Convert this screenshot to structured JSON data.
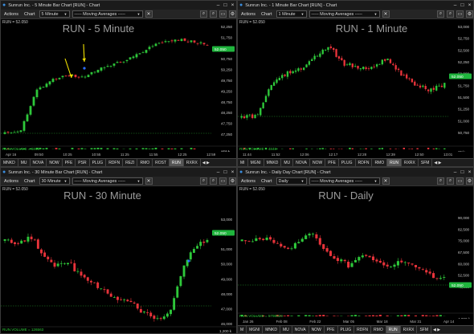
{
  "colors": {
    "up": "#2ec83a",
    "down": "#e8333a",
    "price_flag": "#1fb53d",
    "annotation": "#f2e200",
    "blue_mark": "#2d6cff"
  },
  "panes": [
    {
      "id": "p5",
      "title": "Sunrun Inc. - 5 Minute Bar Chart [RUN] - Chart",
      "actions": "Actions",
      "chart": "Chart",
      "interval": "5 Minute",
      "studies": "----- Moving Averages -----",
      "symbol_line": "RUN = 52.050",
      "big_title": "RUN - 5 Minute",
      "price_flag": "52.050",
      "price_ticks": [
        "52,250",
        "51,750",
        "51,250",
        "50,750",
        "50,250",
        "49,750",
        "49,250",
        "48,750",
        "48,250",
        "47,750",
        "47,250"
      ],
      "volume_label": "RUN.VOLUME = 6845",
      "volume_ticks": [
        "400 k",
        "300 k",
        "150 k"
      ],
      "time_ticks": [
        "Apr 16",
        "09:50",
        "10:25",
        "10:55",
        "11:25",
        "11:55",
        "12:25",
        "12:59"
      ],
      "tabs": [
        "MNKD",
        "MU",
        "NOVA",
        "NOW",
        "PFE",
        "PSR",
        "PLUG",
        "RDFN",
        "REZI",
        "RMO",
        "ROST",
        "RUN",
        "RXRX"
      ],
      "active_tab": "RUN"
    },
    {
      "id": "p1",
      "title": "Sunrun Inc. - 1 Minute Bar Chart [RUN] - Chart",
      "actions": "Actions",
      "chart": "Chart",
      "interval": "1 Minute",
      "studies": "----- Moving Averages -----",
      "symbol_line": "RUN = 52.050",
      "big_title": "RUN - 1 Minute",
      "price_flag": "52.050",
      "price_ticks": [
        "53,000",
        "52,750",
        "52,500",
        "52,250",
        "52,000",
        "51,750",
        "51,500",
        "51,250",
        "51,000",
        "50,750"
      ],
      "volume_label": "RUN.VOLUME = 4848",
      "volume_ticks": [
        "50k",
        "25 k"
      ],
      "time_ticks": [
        "11:44",
        "11:52",
        "12:06",
        "12:17",
        "12:28",
        "12:39",
        "12:50",
        "13:01"
      ],
      "tabs": [
        "MI",
        "MGNI",
        "MNKD",
        "MU",
        "NOVA",
        "NOW",
        "PFE",
        "PLUG",
        "RDFN",
        "RMO",
        "RUN",
        "RXRX",
        "SFM"
      ],
      "active_tab": "RUN"
    },
    {
      "id": "p30",
      "title": "Sunrun Inc. - 30 Minute Bar Chart [RUN] - Chart",
      "actions": "Actions",
      "chart": "Chart",
      "interval": "30 Minute",
      "studies": "----- Moving Averages -----",
      "symbol_line": "RUN = 52.050",
      "big_title": "RUN - 30 Minute",
      "price_flag": "52.050",
      "price_ticks": [
        "53,000",
        "52,000",
        "51,000",
        "50,000",
        "49,000",
        "48,000",
        "47,000",
        "46,000"
      ],
      "volume_label": "RUN.VOLUME = 126563",
      "volume_ticks": [
        "1,200 k"
      ]
    },
    {
      "id": "pd",
      "title": "Sunrun Inc. - Daily Day Chart [RUN] - Chart",
      "actions": "Actions",
      "chart": "Chart",
      "interval": "Daily",
      "studies": "----- Moving Averages -----",
      "symbol_line": "RUN = 52.050",
      "big_title": "RUN - Daily",
      "price_flag": "52.050",
      "price_ticks": [
        "90,000",
        "82,500",
        "75,000",
        "67,500",
        "60,000",
        "52,500",
        "45,000"
      ],
      "volume_label": "RUN.VOLUME = 5798529",
      "volume_ticks": [
        "8,000 k",
        "4,000 k"
      ],
      "time_ticks": [
        "Jan 26",
        "Feb 08",
        "Feb 22",
        "Mar 05",
        "Mar 18",
        "Mar 31",
        "Apr 14"
      ],
      "tabs": [
        "M",
        "MGNI",
        "MNKD",
        "MU",
        "NOVA",
        "NOW",
        "PFE",
        "PLUG",
        "RDFN",
        "RMO",
        "RUN",
        "RXRX",
        "SFM"
      ],
      "active_tab": "RUN"
    }
  ]
}
